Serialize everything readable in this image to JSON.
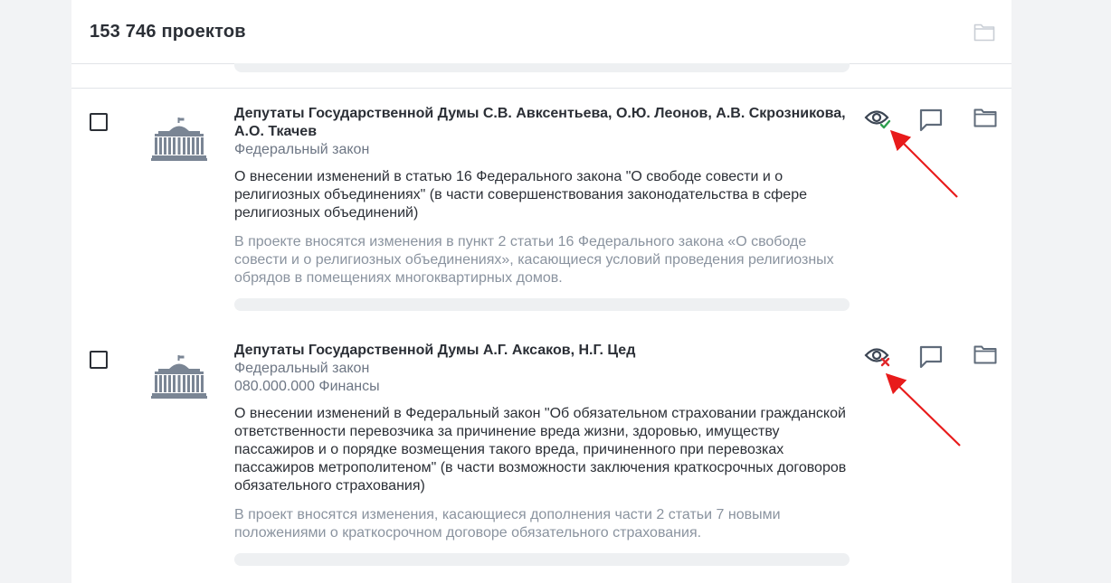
{
  "header": {
    "count_label": "153 746 проектов",
    "folder_icon": "folder-icon"
  },
  "projects": [
    {
      "authors": "Депутаты Государственной Думы С.В. Авксентьева, О.Ю. Леонов, А.В. Скрозникова, А.О. Ткачев",
      "type": "Федеральный закон",
      "title": "О внесении изменений в статью 16 Федерального закона \"О свободе совести и о религиозных объединениях\" (в части совершенствования законодательства в сфере религиозных объединений)",
      "summary": "В проекте вносятся изменения в пункт 2 статьи 16 Федерального закона «О свободе совести и о религиозных объединениях», касающиеся условий проведения религиозных обрядов в помещениях многоквартирных домов.",
      "checked": false,
      "view_status": "viewed",
      "view_icon": "eye-check-icon",
      "status_color": "#2e9e4f"
    },
    {
      "authors": "Депутаты Государственной Думы А.Г. Аксаков, Н.Г. Цед",
      "type": "Федеральный закон",
      "category": "080.000.000 Финансы",
      "title": "О внесении изменений в Федеральный закон \"Об обязательном страховании гражданской ответственности перевозчика за причинение вреда жизни, здоровью, имуществу пассажиров и о порядке возмещения такого вреда, причиненного при перевозках пассажиров метрополитеном\" (в части возможности заключения краткосрочных договоров обязательного страхования)",
      "summary": "В проект вносятся изменения, касающиеся дополнения части 2 статьи 7 новыми положениями о краткосрочном договоре обязательного страхования.",
      "checked": false,
      "view_status": "not-viewed",
      "view_icon": "eye-cross-icon",
      "status_color": "#e0262a"
    }
  ],
  "colors": {
    "accent_red": "#e81b1b",
    "icon_gray": "#5f6b7a",
    "text_dark": "#2b2f36",
    "text_muted": "#8a939f"
  }
}
